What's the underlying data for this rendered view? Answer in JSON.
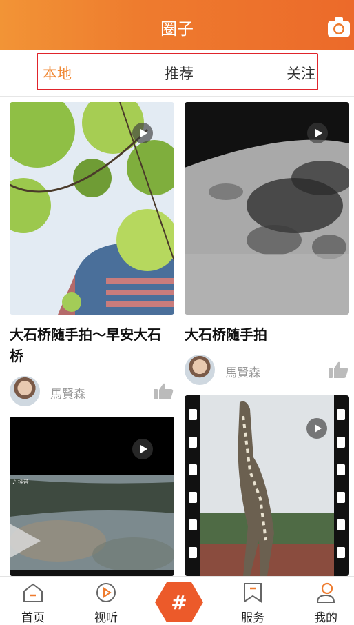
{
  "header": {
    "title": "圈子",
    "camera_icon": "camera-icon"
  },
  "tabs": [
    {
      "label": "本地",
      "active": true
    },
    {
      "label": "推荐",
      "active": false
    },
    {
      "label": "关注",
      "active": false
    }
  ],
  "colors": {
    "accent": "#f08a37",
    "header_start": "#f29436",
    "header_end": "#ec6a2a",
    "highlight_border": "#e0242c"
  },
  "posts": [
    {
      "title": "大石桥随手拍～早安大石桥",
      "author": "馬賢森"
    },
    {
      "title": "大石桥随手拍",
      "author": "馬賢森"
    },
    {
      "title": "",
      "author": ""
    },
    {
      "title": "",
      "author": ""
    }
  ],
  "bottom_nav": [
    {
      "label": "首页",
      "icon": "home-icon"
    },
    {
      "label": "视听",
      "icon": "play-circle-icon"
    },
    {
      "label": "",
      "icon": "hashtag-icon"
    },
    {
      "label": "服务",
      "icon": "bookmark-icon"
    },
    {
      "label": "我的",
      "icon": "user-icon"
    }
  ]
}
